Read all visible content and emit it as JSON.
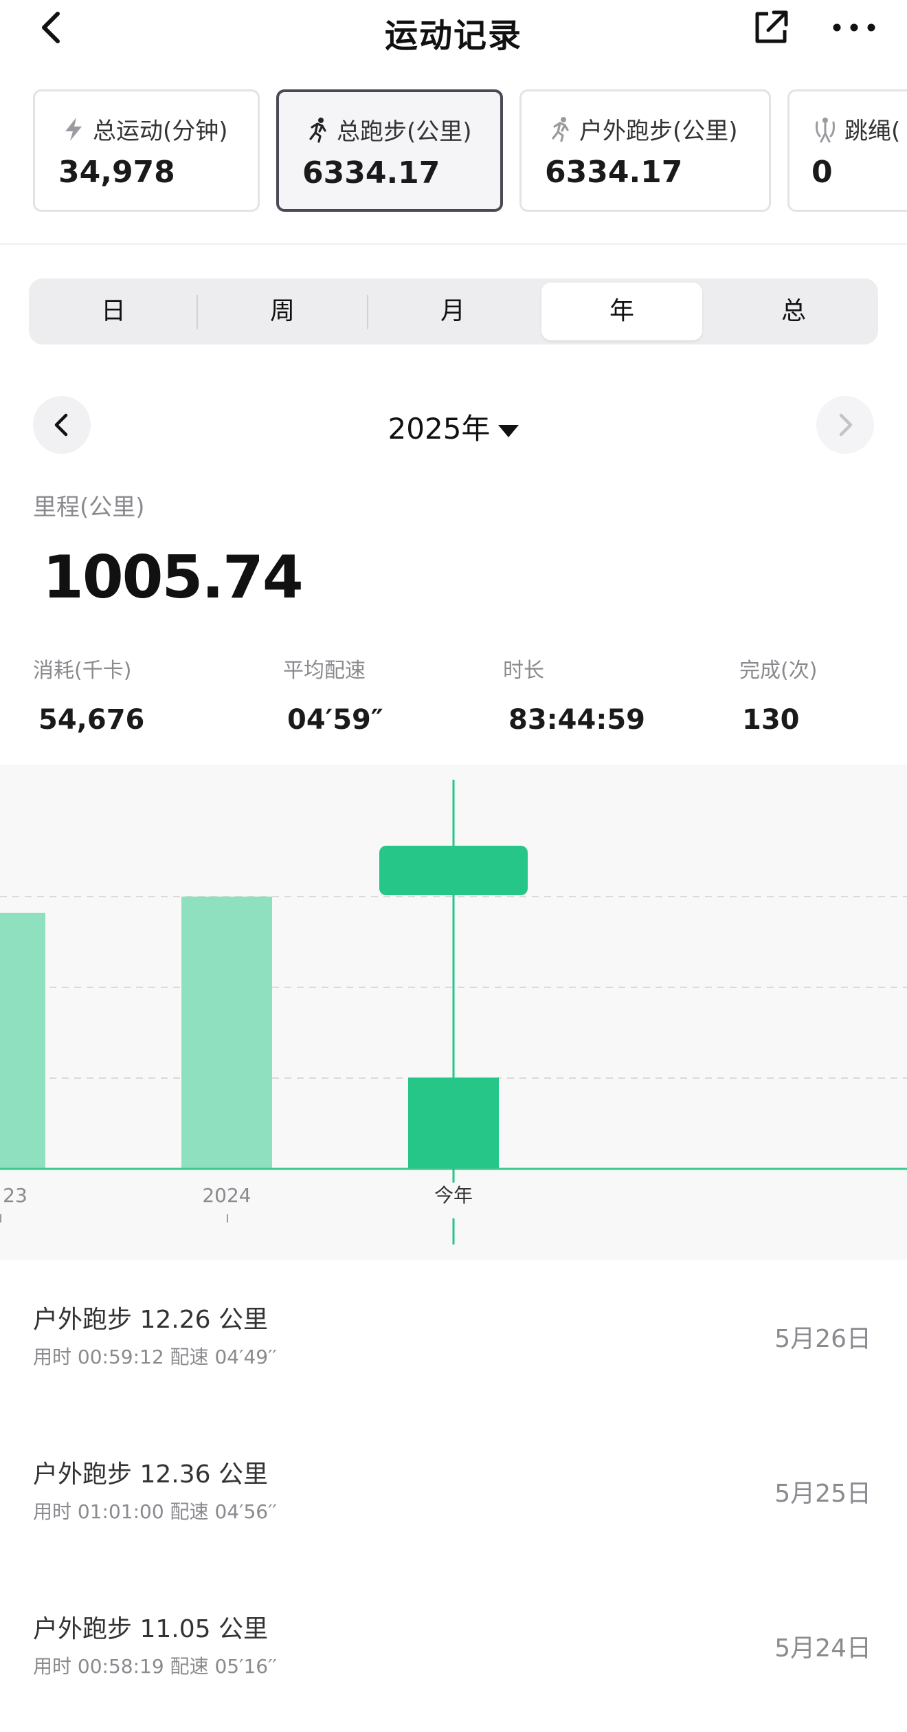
{
  "header": {
    "title": "运动记录",
    "back_icon": "chevron-left-icon",
    "share_icon": "share-external-icon",
    "more_icon": "more-dots-icon"
  },
  "summary_cards": [
    {
      "icon": "lightning-icon",
      "label": "总运动(分钟)",
      "value": "34,978",
      "active": false
    },
    {
      "icon": "running-icon",
      "label": "总跑步(公里)",
      "value": "6334.17",
      "active": true
    },
    {
      "icon": "running-icon",
      "label": "户外跑步(公里)",
      "value": "6334.17",
      "active": false
    },
    {
      "icon": "jump-rope-icon",
      "label": "跳绳(",
      "value": "0",
      "active": false
    }
  ],
  "period_tabs": {
    "items": [
      "日",
      "周",
      "月",
      "年",
      "总"
    ],
    "selected": "年"
  },
  "period_nav": {
    "current": "2025年"
  },
  "distance": {
    "label": "里程(公里)",
    "value": "1005.74"
  },
  "stats": [
    {
      "label": "消耗(千卡)",
      "value": "54,676"
    },
    {
      "label": "平均配速",
      "value": "04′59″"
    },
    {
      "label": "时长",
      "value": "83:44:59"
    },
    {
      "label": "完成(次)",
      "value": "130"
    }
  ],
  "chart_data": {
    "type": "bar",
    "categories": [
      "23",
      "2024",
      "今年"
    ],
    "values": [
      2820,
      3000,
      1005.74
    ],
    "ylim": [
      0,
      4000
    ],
    "grid": true,
    "highlight": "今年",
    "colors": {
      "bar": "#8fe0bf",
      "highlight": "#25c688",
      "axis": "#3cc78e",
      "grid": "#dadade"
    }
  },
  "records": [
    {
      "title": "户外跑步  12.26 公里",
      "sub": "用时 00:59:12    配速 04′49′′",
      "date": "5月26日"
    },
    {
      "title": "户外跑步  12.36 公里",
      "sub": "用时 01:01:00    配速 04′56′′",
      "date": "5月25日"
    },
    {
      "title": "户外跑步  11.05 公里",
      "sub": "用时 00:58:19    配速 05′16′′",
      "date": "5月24日"
    }
  ]
}
